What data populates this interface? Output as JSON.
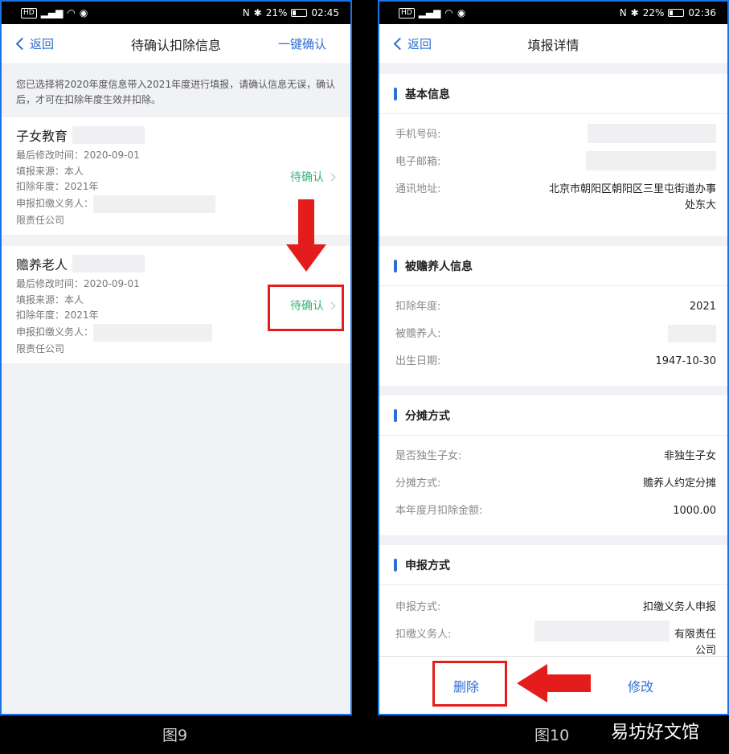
{
  "left": {
    "status": {
      "left_icons": "HD 5G",
      "right": "21%",
      "time": "02:45"
    },
    "nav": {
      "back": "返回",
      "title": "待确认扣除信息",
      "action": "一键确认"
    },
    "notice": "您已选择将2020年度信息带入2021年度进行填报，请确认信息无误，确认后，才可在扣除年度生效并扣除。",
    "items": [
      {
        "title": "子女教育",
        "modified": "最后修改时间：2020-09-01",
        "source": "填报来源：本人",
        "year": "扣除年度：2021年",
        "agent": "申报扣缴义务人：",
        "company": "限责任公司",
        "status": "待确认"
      },
      {
        "title": "赡养老人",
        "modified": "最后修改时间：2020-09-01",
        "source": "填报来源：本人",
        "year": "扣除年度：2021年",
        "agent": "申报扣缴义务人：",
        "company": "限责任公司",
        "status": "待确认"
      }
    ],
    "figure_label": "图9"
  },
  "right": {
    "status": {
      "left_icons": "HD 5G",
      "right": "22%",
      "time": "02:36"
    },
    "nav": {
      "back": "返回",
      "title": "填报详情"
    },
    "sections": [
      {
        "title": "基本信息",
        "rows": [
          {
            "label": "手机号码:",
            "value": ""
          },
          {
            "label": "电子邮箱:",
            "value": ""
          },
          {
            "label": "通讯地址:",
            "value": "北京市朝阳区朝阳区三里屯街道办事处东大"
          }
        ]
      },
      {
        "title": "被赡养人信息",
        "rows": [
          {
            "label": "扣除年度:",
            "value": "2021"
          },
          {
            "label": "被赡养人:",
            "value": ""
          },
          {
            "label": "出生日期:",
            "value": "1947-10-30"
          }
        ]
      },
      {
        "title": "分摊方式",
        "rows": [
          {
            "label": "是否独生子女:",
            "value": "非独生子女"
          },
          {
            "label": "分摊方式:",
            "value": "赡养人约定分摊"
          },
          {
            "label": "本年度月扣除金额:",
            "value": "1000.00"
          }
        ]
      },
      {
        "title": "申报方式",
        "rows": [
          {
            "label": "申报方式:",
            "value": "扣缴义务人申报"
          },
          {
            "label": "扣缴义务人:",
            "value": "有限责任公司"
          }
        ]
      }
    ],
    "buttons": {
      "delete": "删除",
      "modify": "修改"
    },
    "figure_label": "图10"
  },
  "watermark": "易坊好文馆",
  "colors": {
    "accent": "#2d6ed0",
    "confirm": "#3bb37a",
    "highlight": "#e41c1c"
  }
}
